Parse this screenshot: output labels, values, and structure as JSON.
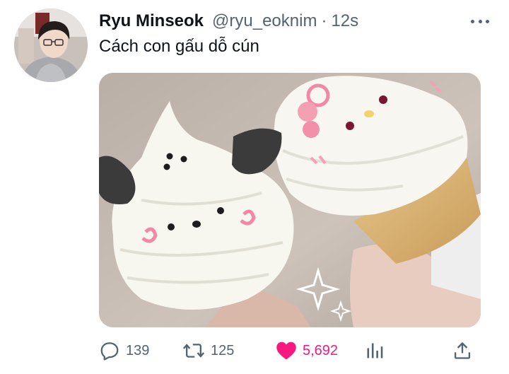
{
  "tweet": {
    "display_name": "Ryu Minseok",
    "handle": "@ryu_eoknim",
    "separator": "·",
    "timestamp": "12s",
    "text": "Cách con gấu dỗ cún",
    "media_icon": "photo-of-two-ice-cream-cones"
  },
  "actions": {
    "reply_count": "139",
    "retweet_count": "125",
    "like_count": "5,692",
    "like_color": "#f91880",
    "icons": [
      "reply-icon",
      "retweet-icon",
      "heart-icon",
      "analytics-icon",
      "share-icon"
    ]
  },
  "colors": {
    "secondary_text": "#536471",
    "primary_text": "#0f1419"
  }
}
